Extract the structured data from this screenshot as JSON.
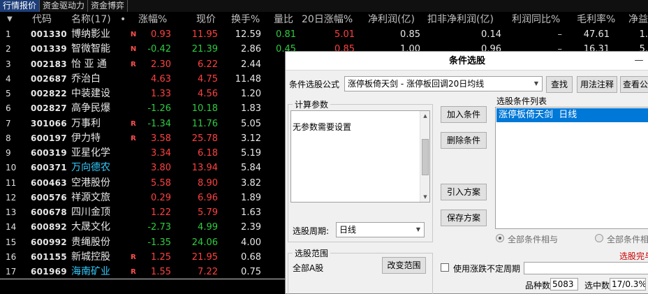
{
  "tabs": [
    "行情报价",
    "资金驱动力",
    "资金博弈"
  ],
  "header": {
    "sort_arrow": "▼",
    "code": "代码",
    "name": "名称(17)",
    "dot": "•",
    "change_pct": "涨幅%",
    "price": "现价",
    "turnover": "换手%",
    "vol_ratio": "量比",
    "change20": "20日涨幅%",
    "net_profit": "净利润(亿)",
    "deduct_profit": "扣非净利润(亿)",
    "profit_yoy": "利润同比%",
    "gross_margin": "毛利率%",
    "net_margin": "净益"
  },
  "rows": [
    {
      "idx": "1",
      "code": "001330",
      "name": "博纳影业",
      "flag": "N",
      "chg": "0.93",
      "price": "11.95",
      "turn": "12.59",
      "vr": "0.81",
      "c20": "5.01",
      "np": "0.85",
      "dnp": "0.14",
      "yoy": "–",
      "gm": "47.61",
      "nm": "1."
    },
    {
      "idx": "2",
      "code": "001339",
      "name": "智微智能",
      "flag": "N",
      "chg": "-0.42",
      "price": "21.39",
      "turn": "2.86",
      "vr": "0.45",
      "c20": "0.85",
      "np": "1.00",
      "dnp": "0.96",
      "yoy": "–",
      "gm": "16.31",
      "nm": "5."
    },
    {
      "idx": "3",
      "code": "002183",
      "name": "怡 亚 通",
      "flag": "R",
      "chg": "2.30",
      "price": "6.22",
      "turn": "2.44",
      "vr": "1",
      "c20": "",
      "np": "",
      "dnp": "",
      "yoy": "",
      "gm": "",
      "nm": ""
    },
    {
      "idx": "4",
      "code": "002687",
      "name": "乔治白",
      "flag": "",
      "chg": "4.63",
      "price": "4.75",
      "turn": "11.48",
      "vr": "5.",
      "c20": "",
      "np": "",
      "dnp": "",
      "yoy": "",
      "gm": "",
      "nm": ""
    },
    {
      "idx": "5",
      "code": "002822",
      "name": "中装建设",
      "flag": "",
      "chg": "1.33",
      "price": "4.56",
      "turn": "1.20",
      "vr": "1",
      "c20": "",
      "np": "",
      "dnp": "",
      "yoy": "",
      "gm": "",
      "nm": ""
    },
    {
      "idx": "6",
      "code": "002827",
      "name": "高争民爆",
      "flag": "",
      "chg": "-1.26",
      "price": "10.18",
      "turn": "1.83",
      "vr": "0",
      "c20": "",
      "np": "",
      "dnp": "",
      "yoy": "",
      "gm": "",
      "nm": ""
    },
    {
      "idx": "7",
      "code": "301066",
      "name": "万事利",
      "flag": "R",
      "chg": "-1.34",
      "price": "11.76",
      "turn": "5.05",
      "vr": "0",
      "c20": "",
      "np": "",
      "dnp": "",
      "yoy": "",
      "gm": "",
      "nm": ""
    },
    {
      "idx": "8",
      "code": "600197",
      "name": "伊力特",
      "flag": "R",
      "chg": "3.58",
      "price": "25.78",
      "turn": "3.12",
      "vr": "0",
      "c20": "",
      "np": "",
      "dnp": "",
      "yoy": "",
      "gm": "",
      "nm": ""
    },
    {
      "idx": "9",
      "code": "600319",
      "name": "亚星化学",
      "flag": "",
      "chg": "3.34",
      "price": "6.18",
      "turn": "5.19",
      "vr": "2",
      "c20": "",
      "np": "",
      "dnp": "",
      "yoy": "",
      "gm": "",
      "nm": ""
    },
    {
      "idx": "10",
      "code": "600371",
      "name": "万向德农",
      "flag": "",
      "chg": "3.80",
      "price": "13.94",
      "turn": "5.84",
      "vr": "1",
      "c20": "",
      "np": "",
      "dnp": "",
      "yoy": "",
      "gm": "",
      "nm": ""
    },
    {
      "idx": "11",
      "code": "600463",
      "name": "空港股份",
      "flag": "",
      "chg": "5.58",
      "price": "8.90",
      "turn": "3.82",
      "vr": "1",
      "c20": "",
      "np": "",
      "dnp": "",
      "yoy": "",
      "gm": "",
      "nm": ""
    },
    {
      "idx": "12",
      "code": "600576",
      "name": "祥源文旅",
      "flag": "",
      "chg": "0.29",
      "price": "6.96",
      "turn": "1.89",
      "vr": "0",
      "c20": "",
      "np": "",
      "dnp": "",
      "yoy": "",
      "gm": "",
      "nm": ""
    },
    {
      "idx": "13",
      "code": "600678",
      "name": "四川金顶",
      "flag": "",
      "chg": "1.22",
      "price": "5.79",
      "turn": "1.63",
      "vr": "0",
      "c20": "",
      "np": "",
      "dnp": "",
      "yoy": "",
      "gm": "",
      "nm": ""
    },
    {
      "idx": "14",
      "code": "600892",
      "name": "大晟文化",
      "flag": "",
      "chg": "-2.73",
      "price": "4.99",
      "turn": "2.39",
      "vr": "0",
      "c20": "",
      "np": "",
      "dnp": "",
      "yoy": "",
      "gm": "",
      "nm": ""
    },
    {
      "idx": "15",
      "code": "600992",
      "name": "贵绳股份",
      "flag": "",
      "chg": "-1.35",
      "price": "24.06",
      "turn": "4.00",
      "vr": "0",
      "c20": "",
      "np": "",
      "dnp": "",
      "yoy": "",
      "gm": "",
      "nm": ""
    },
    {
      "idx": "16",
      "code": "601155",
      "name": "新城控股",
      "flag": "R",
      "chg": "1.25",
      "price": "21.95",
      "turn": "0.68",
      "vr": "0",
      "c20": "",
      "np": "",
      "dnp": "",
      "yoy": "",
      "gm": "",
      "nm": ""
    },
    {
      "idx": "17",
      "code": "601969",
      "name": "海南矿业",
      "flag": "R",
      "chg": "1.55",
      "price": "7.22",
      "turn": "0.75",
      "vr": "0",
      "c20": "",
      "np": "",
      "dnp": "",
      "yoy": "",
      "gm": "",
      "nm": ""
    }
  ],
  "dialog": {
    "title": "条件选股",
    "minimize": "—",
    "formula_label": "条件选股公式",
    "formula_value": "涨停板倚天剑 - 涨停板回调20日均线",
    "find_btn": "查找",
    "usage_btn": "用法注释",
    "view_btn": "查看公",
    "params_title": "计算参数",
    "params_text": "无参数需要设置",
    "add_btn": "加入条件",
    "delete_btn": "删除条件",
    "import_btn": "引入方案",
    "save_btn": "保存方案",
    "list_title": "选股条件列表",
    "list_items": [
      "涨停板倚天剑  日线"
    ],
    "period_label": "选股周期:",
    "period_value": "日线",
    "and_label": "全部条件相与",
    "or_label": "全部条件相",
    "range_title": "选股范围",
    "range_value": "全部A股",
    "change_range_btn": "改变范围",
    "status_text": "选股完与",
    "use_period_label": "使用涨跌不定周期",
    "count_label": "品种数",
    "count_value": "5083",
    "selected_label": "选中数",
    "selected_value": "17/0.3%"
  },
  "colors": {
    "background": "#000000",
    "up": "#ff4040",
    "down": "#2ecc40",
    "highlight_name": "#33ccff",
    "selection_blue": "#0078d7",
    "active_tab": "#1c3d78"
  }
}
